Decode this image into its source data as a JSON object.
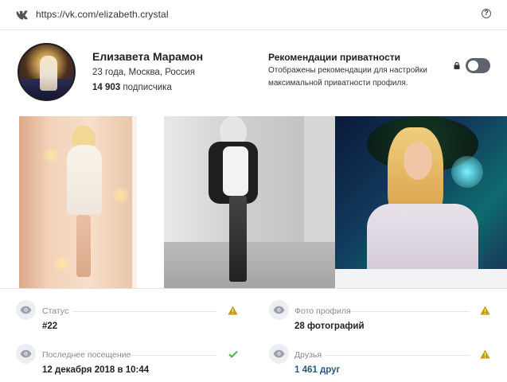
{
  "topbar": {
    "url": "https://vk.com/elizabeth.crystal"
  },
  "profile": {
    "name": "Елизавета Марамон",
    "info": "23 года, Москва, Россия",
    "subscribers_count": "14 903",
    "subscribers_label": "подписчика"
  },
  "privacy": {
    "title": "Рекомендации приватности",
    "text": "Отображены рекомендации для настройки максимальной приватности профиля.",
    "toggle_on": false
  },
  "fields": [
    {
      "label": "Статус",
      "value": "#22",
      "status": "warning"
    },
    {
      "label": "Фото профиля",
      "value": "28 фотографий",
      "status": "warning"
    },
    {
      "label": "Последнее посещение",
      "value": "12 декабря 2018 в 10:44",
      "status": "ok"
    },
    {
      "label": "Друзья",
      "value": "1 461 друг",
      "status": "warning"
    }
  ],
  "colors": {
    "warning": "#c99a0a",
    "ok": "#4bb34b",
    "link": "#2a5885",
    "toggle_off": "#5d6470"
  },
  "icons": {
    "vk": "vk-logo-icon",
    "help": "help-icon",
    "lock": "lock-icon",
    "eye": "eye-icon",
    "warning": "warning-icon",
    "check": "check-icon"
  }
}
